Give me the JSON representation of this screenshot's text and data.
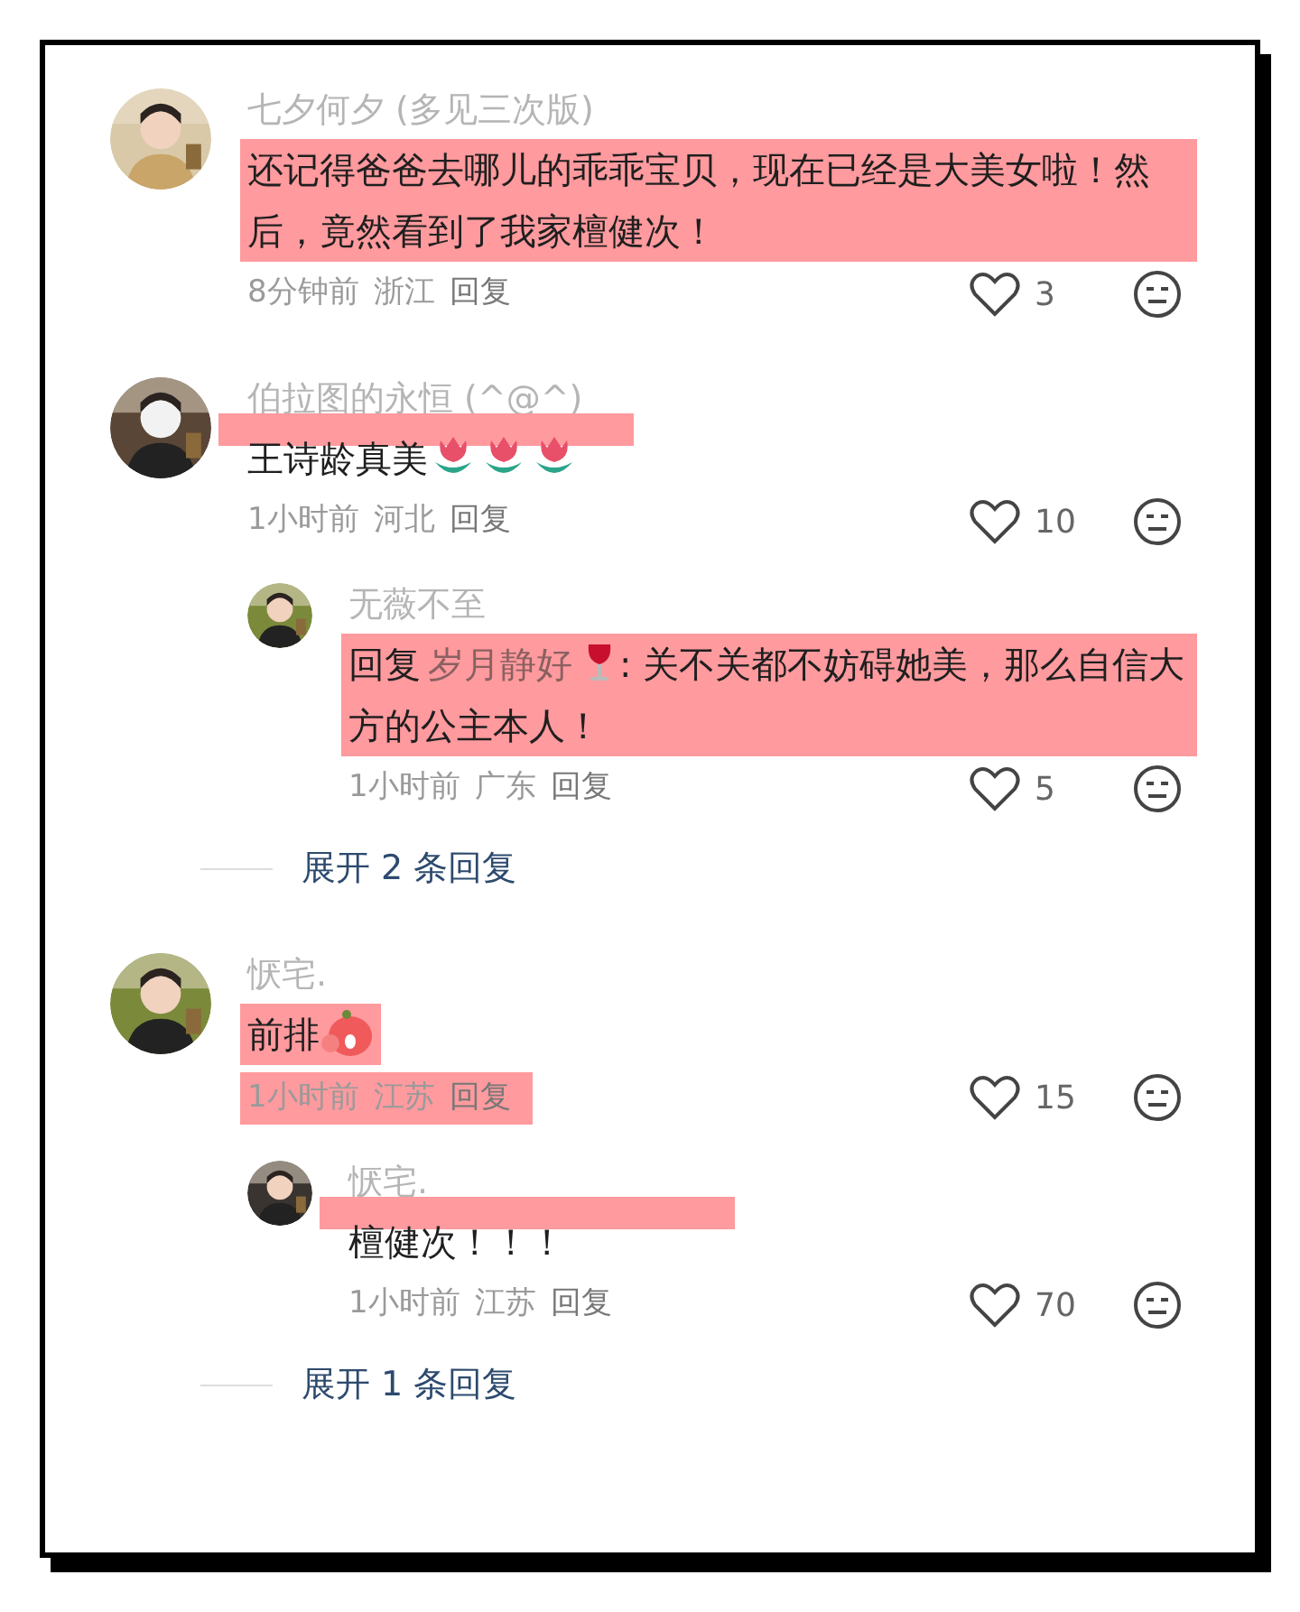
{
  "comments": [
    {
      "author": "七夕何夕 (多见三次版)",
      "body": [
        {
          "kind": "text",
          "text": "还记得爸爸去哪儿的乖乖宝贝，现在已经是大美女啦！然后，竟然看到了我家檀健次！"
        }
      ],
      "highlight_text": true,
      "highlight_strip": false,
      "highlight_meta": false,
      "time": "8分钟前",
      "region": "浙江",
      "reply_label": "回复",
      "likes": "3"
    },
    {
      "author": "伯拉图的永恒 (^@^)",
      "body": [
        {
          "kind": "text",
          "text": "王诗龄真美"
        },
        {
          "kind": "tulip"
        },
        {
          "kind": "tulip"
        },
        {
          "kind": "tulip"
        }
      ],
      "highlight_text": false,
      "highlight_strip": true,
      "highlight_meta": false,
      "time": "1小时前",
      "region": "河北",
      "reply_label": "回复",
      "likes": "10",
      "replies": [
        {
          "author": "无薇不至",
          "body": [
            {
              "kind": "text",
              "text": "回复"
            },
            {
              "kind": "mention",
              "text": "岁月静好"
            },
            {
              "kind": "wine"
            },
            {
              "kind": "text",
              "text": ": 关不关都不妨碍她美，那么自信大方的公主本人！"
            }
          ],
          "highlight_text": true,
          "highlight_strip": false,
          "highlight_meta": false,
          "time": "1小时前",
          "region": "广东",
          "reply_label": "回复",
          "likes": "5"
        }
      ],
      "expand": "展开 2 条回复"
    },
    {
      "author": "恹宅.",
      "body": [
        {
          "kind": "text",
          "text": "前排"
        },
        {
          "kind": "sticker"
        }
      ],
      "highlight_text": true,
      "highlight_strip": false,
      "highlight_meta": true,
      "time": "1小时前",
      "region": "江苏",
      "reply_label": "回复",
      "likes": "15",
      "replies": [
        {
          "author": "恹宅.",
          "body": [
            {
              "kind": "text",
              "text": "檀健次！！！"
            }
          ],
          "highlight_text": false,
          "highlight_strip": true,
          "highlight_meta": false,
          "time": "1小时前",
          "region": "江苏",
          "reply_label": "回复",
          "likes": "70"
        }
      ],
      "expand": "展开 1 条回复"
    }
  ]
}
